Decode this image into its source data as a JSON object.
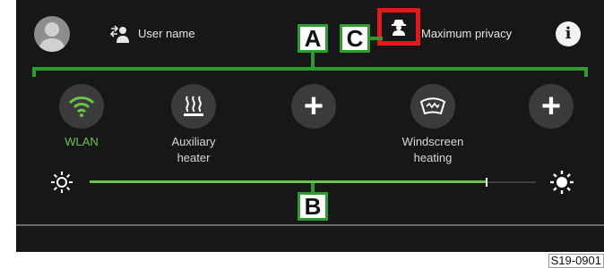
{
  "status_bar": {
    "user_name": "User name",
    "privacy_label": "Maximum privacy",
    "info_symbol": "i",
    "avatar_icon": "person-silhouette-icon",
    "user_switch_icon": "switch-user-icon",
    "privacy_icon": "incognito-agent-icon"
  },
  "callouts": {
    "a": "A",
    "b": "B",
    "c": "C",
    "color": "#2f9c31",
    "highlight_color": "#e01b1b"
  },
  "tiles": [
    {
      "label_line1": "WLAN",
      "label_line2": "",
      "icon": "wifi-icon",
      "active": true
    },
    {
      "label_line1": "Auxiliary",
      "label_line2": "heater",
      "icon": "aux-heater-icon",
      "active": false
    },
    {
      "label_line1": "",
      "label_line2": "",
      "icon": "plus-icon",
      "active": false
    },
    {
      "label_line1": "Windscreen",
      "label_line2": "heating",
      "icon": "windscreen-heating-icon",
      "active": false
    },
    {
      "label_line1": "",
      "label_line2": "",
      "icon": "plus-icon",
      "active": false
    }
  ],
  "plus_symbol": "+",
  "brightness": {
    "level_fraction": 0.89,
    "min_icon": "brightness-low-icon",
    "max_icon": "brightness-high-icon",
    "accent": "#6cc24a"
  },
  "figure_code": "S19-0901"
}
